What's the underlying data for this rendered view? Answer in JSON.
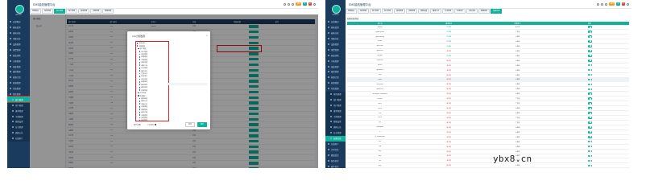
{
  "left": {
    "brand": "admin",
    "title": "EMS能效管理平台",
    "badges": [
      "123",
      "2",
      "0"
    ],
    "tabs": [
      "管理首页",
      "角色管理",
      "部门管理",
      "用户管理",
      "菜单管理",
      "字典管理",
      "数据权限"
    ],
    "active_tab": 2,
    "sidebar_items": [
      {
        "label": "运营概况",
        "sub": false
      },
      {
        "label": "能耗监测",
        "sub": false
      },
      {
        "label": "能耗分析",
        "sub": false
      },
      {
        "label": "用能分析",
        "sub": false
      },
      {
        "label": "设备管理",
        "sub": false
      },
      {
        "label": "报警管理",
        "sub": false
      },
      {
        "label": "能效诊断",
        "sub": false
      },
      {
        "label": "节能管理",
        "sub": false
      },
      {
        "label": "报表管理",
        "sub": false
      },
      {
        "label": "碳排管理",
        "sub": false
      },
      {
        "label": "能源计划",
        "sub": false
      },
      {
        "label": "能源管理",
        "sub": false
      },
      {
        "label": "系统管理",
        "sub": false
      },
      {
        "label": "角色管理",
        "sub": false
      },
      {
        "label": "部门管理",
        "sub": true,
        "active": true,
        "highlight": true
      },
      {
        "label": "用户管理",
        "sub": true
      },
      {
        "label": "菜单管理",
        "sub": true
      },
      {
        "label": "字典管理",
        "sub": true
      },
      {
        "label": "参数设置",
        "sub": true
      },
      {
        "label": "日志管理",
        "sub": true
      },
      {
        "label": "通知公告",
        "sub": true
      },
      {
        "label": "在线用户",
        "sub": true
      }
    ],
    "tree_head": "部门列表",
    "tree_item": "总公司",
    "toolbar": [
      "新增",
      "修改",
      "删除"
    ],
    "grid_header": [
      "部门名称",
      "部门编号",
      "负责人",
      "状态",
      "数据权限",
      "操作"
    ],
    "grid_rows": [
      [
        "总公司",
        "100",
        "admin",
        "正常",
        "",
        ""
      ],
      [
        "研发部",
        "101",
        "",
        "正常",
        "",
        ""
      ],
      [
        "市场部",
        "102",
        "",
        "正常",
        "",
        ""
      ],
      [
        "测试部",
        "103",
        "",
        "正常",
        "",
        ""
      ],
      [
        "财务部",
        "104",
        "",
        "正常",
        "",
        ""
      ],
      [
        "运维部",
        "105",
        "",
        "正常",
        "",
        ""
      ],
      [
        "生产部",
        "106",
        "",
        "正常",
        "",
        ""
      ],
      [
        "一车间",
        "107",
        "",
        "正常",
        "",
        ""
      ],
      [
        "二车间",
        "108",
        "",
        "正常",
        "",
        ""
      ],
      [
        "三车间",
        "109",
        "",
        "正常",
        "",
        ""
      ],
      [
        "四车间",
        "110",
        "",
        "正常",
        "",
        ""
      ],
      [
        "质检部",
        "111",
        "",
        "正常",
        "",
        ""
      ],
      [
        "采购部",
        "112",
        "",
        "正常",
        "",
        ""
      ],
      [
        "仓储部",
        "113",
        "",
        "正常",
        "",
        ""
      ],
      [
        "行政部",
        "114",
        "",
        "正常",
        "",
        ""
      ],
      [
        "安全部",
        "115",
        "",
        "正常",
        "",
        ""
      ],
      [
        "后勤部",
        "116",
        "",
        "正常",
        "",
        ""
      ],
      [
        "人事部",
        "117",
        "",
        "正常",
        "",
        ""
      ],
      [
        "能源部",
        "118",
        "",
        "正常",
        "",
        ""
      ],
      [
        "设备部",
        "119",
        "",
        "正常",
        "",
        ""
      ],
      [
        "动力部",
        "120",
        "",
        "正常",
        "",
        ""
      ],
      [
        "计量部",
        "121",
        "",
        "正常",
        "",
        ""
      ],
      [
        "信息部",
        "122",
        "",
        "正常",
        "",
        ""
      ],
      [
        "法务部",
        "123",
        "",
        "正常",
        "",
        ""
      ],
      [
        "销售部",
        "124",
        "",
        "正常",
        "",
        ""
      ],
      [
        "客服部",
        "125",
        "",
        "正常",
        "",
        ""
      ],
      [
        "综合部",
        "126",
        "",
        "正常",
        "",
        ""
      ]
    ],
    "modal": {
      "title": "xxx分配权限",
      "close": "×",
      "tree": [
        {
          "label": "选择全部",
          "lvl": 1
        },
        {
          "label": "系统管理",
          "lvl": 1
        },
        {
          "label": "部门管理",
          "lvl": 2
        },
        {
          "label": "用户管理",
          "lvl": 3
        },
        {
          "label": "角色管理",
          "lvl": 3
        },
        {
          "label": "菜单管理",
          "lvl": 3
        },
        {
          "label": "字典管理",
          "lvl": 3
        },
        {
          "label": "参数设置",
          "lvl": 3
        },
        {
          "label": "通知公告",
          "lvl": 3
        },
        {
          "label": "日志管理",
          "lvl": 3
        },
        {
          "label": "操作日志",
          "lvl": 3
        },
        {
          "label": "登录日志",
          "lvl": 3
        },
        {
          "label": "在线用户",
          "lvl": 3
        },
        {
          "label": "定时任务",
          "lvl": 3
        },
        {
          "label": "数据监控",
          "lvl": 3
        },
        {
          "label": "服务监控",
          "lvl": 3
        },
        {
          "label": "缓存监控",
          "lvl": 3
        },
        {
          "label": "表单构建",
          "lvl": 3
        },
        {
          "label": "代码生成",
          "lvl": 2
        },
        {
          "label": "系统接口",
          "lvl": 2
        },
        {
          "label": "能耗监测",
          "lvl": 3
        },
        {
          "label": "能耗分析",
          "lvl": 3
        },
        {
          "label": "用能分析",
          "lvl": 3
        },
        {
          "label": "设备管理",
          "lvl": 3
        },
        {
          "label": "报警管理",
          "lvl": 3
        },
        {
          "label": "能效诊断",
          "lvl": 3
        },
        {
          "label": "节能管理",
          "lvl": 3
        },
        {
          "label": "报表管理",
          "lvl": 3
        },
        {
          "label": "碳排管理",
          "lvl": 3
        }
      ],
      "foot_opt1": "展开/折叠",
      "foot_opt2": "父子联动",
      "cancel": "取消",
      "confirm": "确定"
    }
  },
  "right": {
    "brand": "admin",
    "title": "EMS能效管理平台",
    "badges": [
      "123",
      "2",
      "0"
    ],
    "tabs": [
      "管理首页",
      "角色管理",
      "部门管理",
      "用户管理",
      "菜单管理",
      "字典管理",
      "参数设置",
      "通知公告",
      "日志管理",
      "在线用户",
      "定时任务",
      "数据监控",
      "权限分配"
    ],
    "active_tab": 12,
    "sidebar_items": [
      {
        "label": "运营概况",
        "sub": false
      },
      {
        "label": "能耗监测",
        "sub": false
      },
      {
        "label": "能耗分析",
        "sub": false
      },
      {
        "label": "用能分析",
        "sub": false
      },
      {
        "label": "设备管理",
        "sub": false
      },
      {
        "label": "报警管理",
        "sub": false
      },
      {
        "label": "能效诊断",
        "sub": false
      },
      {
        "label": "节能管理",
        "sub": false
      },
      {
        "label": "报表管理",
        "sub": false
      },
      {
        "label": "碳排管理",
        "sub": false
      },
      {
        "label": "能源计划",
        "sub": false
      },
      {
        "label": "能源管理",
        "sub": false
      },
      {
        "label": "系统管理",
        "sub": false
      },
      {
        "label": "角色管理",
        "sub": true
      },
      {
        "label": "部门管理",
        "sub": true
      },
      {
        "label": "用户管理",
        "sub": true
      },
      {
        "label": "菜单管理",
        "sub": true
      },
      {
        "label": "字典管理",
        "sub": true
      },
      {
        "label": "参数设置",
        "sub": true
      },
      {
        "label": "通知公告",
        "sub": true
      },
      {
        "label": "日志管理",
        "sub": true
      },
      {
        "label": "权限分配",
        "sub": true,
        "active": true
      },
      {
        "label": "在线用户",
        "sub": false
      },
      {
        "label": "定时任务",
        "sub": false
      },
      {
        "label": "数据监控",
        "sub": false
      },
      {
        "label": "服务监控",
        "sub": false
      },
      {
        "label": "缓存监控",
        "sub": false
      }
    ],
    "crumb": "权限分配列表",
    "table_header": [
      "用户名",
      "权限状态",
      "所属部门",
      "操作"
    ],
    "rows": [
      {
        "name": "admin",
        "status": "已分配",
        "status_cls": "yes",
        "dept": "总公司"
      },
      {
        "name": "guanliyuan",
        "status": "已分配",
        "status_cls": "yes",
        "dept": "广东省"
      },
      {
        "name": "gaozhihong",
        "status": "已分配",
        "status_cls": "yes",
        "dept": "上海市"
      },
      {
        "name": "lidian",
        "status": "已分配",
        "status_cls": "yes",
        "dept": "上海市"
      },
      {
        "name": "qinhehui",
        "status": "已分配",
        "status_cls": "yes",
        "dept": "上海市"
      },
      {
        "name": "guanli01",
        "status": "未分配",
        "status_cls": "no",
        "dept": "上海市"
      },
      {
        "name": "yunwei",
        "status": "已分配",
        "status_cls": "yes",
        "dept": "上海市"
      },
      {
        "name": "haochen",
        "status": "未分配",
        "status_cls": "no",
        "dept": "上海市"
      },
      {
        "name": "jiance",
        "status": "未分配",
        "status_cls": "no",
        "dept": "上海市"
      },
      {
        "name": "guanliyi3",
        "status": "未分配",
        "status_cls": "no",
        "dept": "上海市"
      },
      {
        "name": "test",
        "status": "未分配",
        "status_cls": "no",
        "dept": "上海市"
      },
      {
        "name": "tabb",
        "status": "未分配",
        "status_cls": "no",
        "dept": "上海市",
        "sel": true
      },
      {
        "name": "xiaoyuan",
        "status": "未分配",
        "status_cls": "no",
        "dept": "上海市"
      },
      {
        "name": "qianchen",
        "status": "未分配",
        "status_cls": "no",
        "dept": "上海市"
      },
      {
        "name": "zhongxin_tiaodushi",
        "status": "未分配",
        "status_cls": "no",
        "dept": "上海市"
      },
      {
        "name": "zhiban",
        "status": "未分配",
        "status_cls": "no",
        "dept": "广东省"
      },
      {
        "name": "test2",
        "status": "未分配",
        "status_cls": "no",
        "dept": "广东省"
      },
      {
        "name": "test3",
        "status": "未分配",
        "status_cls": "no",
        "dept": "上海市"
      },
      {
        "name": "lim",
        "status": "未分配",
        "status_cls": "no",
        "dept": "上海市"
      },
      {
        "name": "test5",
        "status": "未分配",
        "status_cls": "no",
        "dept": "广东省"
      },
      {
        "name": "yy",
        "status": "未分配",
        "status_cls": "no",
        "dept": "广东省"
      },
      {
        "name": "zhangwei",
        "status": "未分配",
        "status_cls": "no",
        "dept": "上海市"
      },
      {
        "name": "tt",
        "status": "未分配",
        "status_cls": "no",
        "dept": "上海市"
      },
      {
        "name": "ly_zhuanxian",
        "status": "未分配",
        "status_cls": "no",
        "dept": "上海市"
      },
      {
        "name": "sxs",
        "status": "未分配",
        "status_cls": "no",
        "dept": "上海市"
      },
      {
        "name": "xjp",
        "status": "未分配",
        "status_cls": "no",
        "dept": "上海市"
      },
      {
        "name": "hyy",
        "status": "未分配",
        "status_cls": "no",
        "dept": "上海市"
      },
      {
        "name": "dsh",
        "status": "未分配",
        "status_cls": "no",
        "dept": "上海市"
      },
      {
        "name": "lnz",
        "status": "未分配",
        "status_cls": "no",
        "dept": "上海市"
      },
      {
        "name": "qcy",
        "status": "未分配",
        "status_cls": "no",
        "dept": "上海市"
      },
      {
        "name": "wkf",
        "status": "未分配",
        "status_cls": "no",
        "dept": "上海市"
      },
      {
        "name": "ywt",
        "status": "未分配",
        "status_cls": "no",
        "dept": "上海市"
      },
      {
        "name": "zlx",
        "status": "未分配",
        "status_cls": "no",
        "dept": "上海市"
      },
      {
        "name": "hmh",
        "status": "未分配",
        "status_cls": "no",
        "dept": "上海市"
      }
    ]
  },
  "watermark": "ybx8.cn",
  "colors": {
    "sidebar": "#1a3b5d",
    "accent": "#0fb29c",
    "alert": "#e02020"
  }
}
